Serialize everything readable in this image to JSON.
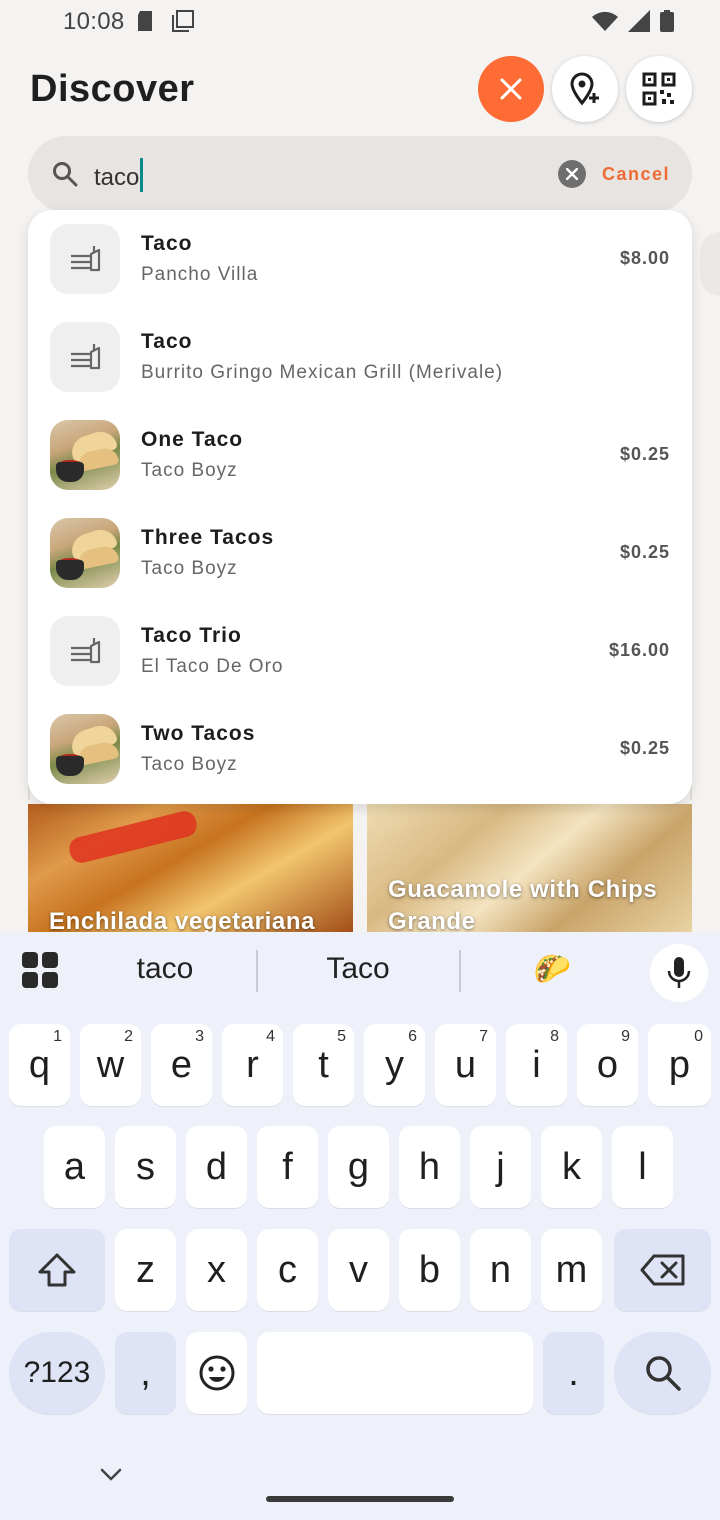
{
  "status_bar": {
    "time": "10:08"
  },
  "header": {
    "title": "Discover"
  },
  "search": {
    "query": "taco",
    "cancel_label": "Cancel"
  },
  "background_cards": [
    {
      "label": "Enchilada vegetariana"
    },
    {
      "label": "Guacamole with Chips Grande"
    }
  ],
  "results": [
    {
      "name": "Taco",
      "restaurant": "Pancho Villa",
      "price": "$8.00",
      "thumb": "placeholder"
    },
    {
      "name": "Taco",
      "restaurant": "Burrito Gringo Mexican Grill (Merivale)",
      "price": "",
      "thumb": "placeholder"
    },
    {
      "name": "One Taco",
      "restaurant": "Taco Boyz",
      "price": "$0.25",
      "thumb": "photo"
    },
    {
      "name": "Three Tacos",
      "restaurant": "Taco Boyz",
      "price": "$0.25",
      "thumb": "photo"
    },
    {
      "name": "Taco Trio",
      "restaurant": "El Taco De Oro",
      "price": "$16.00",
      "thumb": "placeholder"
    },
    {
      "name": "Two Tacos",
      "restaurant": "Taco Boyz",
      "price": "$0.25",
      "thumb": "photo"
    }
  ],
  "keyboard": {
    "suggestions": [
      "taco",
      "Taco",
      "🌮"
    ],
    "row1": [
      {
        "key": "q",
        "hint": "1"
      },
      {
        "key": "w",
        "hint": "2"
      },
      {
        "key": "e",
        "hint": "3"
      },
      {
        "key": "r",
        "hint": "4"
      },
      {
        "key": "t",
        "hint": "5"
      },
      {
        "key": "y",
        "hint": "6"
      },
      {
        "key": "u",
        "hint": "7"
      },
      {
        "key": "i",
        "hint": "8"
      },
      {
        "key": "o",
        "hint": "9"
      },
      {
        "key": "p",
        "hint": "0"
      }
    ],
    "row2": [
      "a",
      "s",
      "d",
      "f",
      "g",
      "h",
      "j",
      "k",
      "l"
    ],
    "row3": [
      "z",
      "x",
      "c",
      "v",
      "b",
      "n",
      "m"
    ],
    "symbols_label": "?123",
    "comma_label": ",",
    "period_label": "."
  },
  "colors": {
    "accent": "#ef6b35",
    "close_button": "#ff6b35",
    "caret": "#0a8a8a"
  }
}
